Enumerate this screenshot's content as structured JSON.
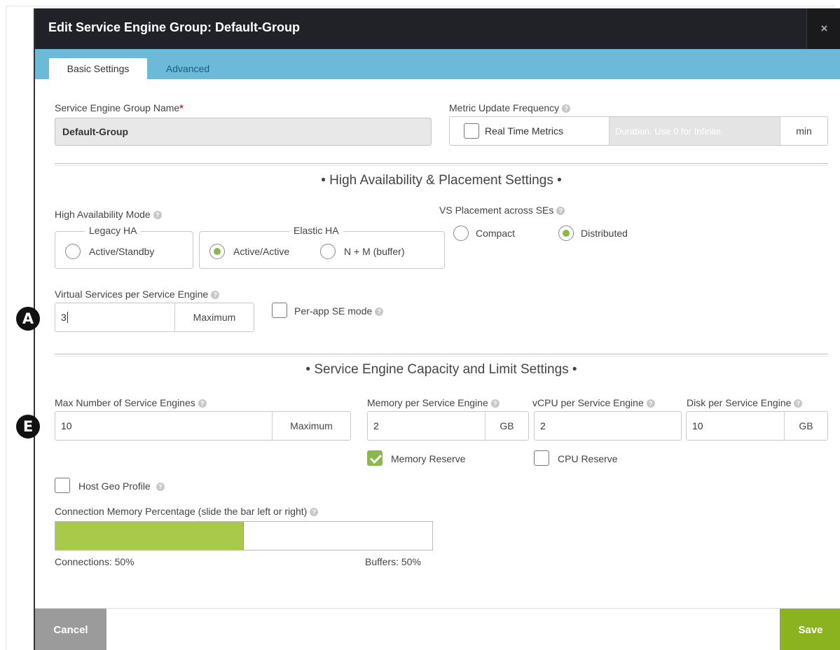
{
  "dialog": {
    "title": "Edit Service Engine Group: Default-Group",
    "close_glyph": "×"
  },
  "tabs": [
    {
      "label": "Basic Settings",
      "active": true
    },
    {
      "label": "Advanced",
      "active": false
    }
  ],
  "se_group_name": {
    "label": "Service Engine Group Name",
    "required_mark": "*",
    "value": "Default-Group"
  },
  "metric_update": {
    "label": "Metric Update Frequency",
    "real_time_label": "Real Time Metrics",
    "real_time_checked": false,
    "duration_placeholder": "Duration. Use 0 for Infinite.",
    "unit": "min"
  },
  "sections": {
    "ha_placement": "• High Availability & Placement Settings •",
    "capacity": "• Service Engine Capacity and Limit Settings •"
  },
  "ha_mode": {
    "label": "High Availability Mode",
    "legacy_legend": "Legacy HA",
    "elastic_legend": "Elastic HA",
    "options": [
      {
        "label": "Active/Standby",
        "checked": false
      },
      {
        "label": "Active/Active",
        "checked": true
      },
      {
        "label": "N + M (buffer)",
        "checked": false
      }
    ]
  },
  "vs_placement": {
    "label": "VS Placement across SEs",
    "options": [
      {
        "label": "Compact",
        "checked": false
      },
      {
        "label": "Distributed",
        "checked": true
      }
    ]
  },
  "vs_per_se": {
    "label": "Virtual Services per Service Engine",
    "value": "3",
    "unit": "Maximum"
  },
  "per_app": {
    "label": "Per-app SE mode",
    "checked": false
  },
  "max_se": {
    "label": "Max Number of Service Engines",
    "value": "10",
    "unit": "Maximum"
  },
  "memory_per_se": {
    "label": "Memory per Service Engine",
    "value": "2",
    "unit": "GB"
  },
  "vcpu_per_se": {
    "label": "vCPU per Service Engine",
    "value": "2"
  },
  "disk_per_se": {
    "label": "Disk per Service Engine",
    "value": "10",
    "unit": "GB"
  },
  "memory_reserve": {
    "label": "Memory Reserve",
    "checked": true
  },
  "cpu_reserve": {
    "label": "CPU Reserve",
    "checked": false
  },
  "host_geo": {
    "label": "Host Geo Profile",
    "checked": false
  },
  "connection_memory": {
    "label": "Connection Memory Percentage (slide the bar left or right)",
    "connections_label": "Connections: 50%",
    "buffers_label": "Buffers: 50%",
    "connections_percent": 50
  },
  "footer": {
    "cancel_label": "Cancel",
    "save_label": "Save"
  },
  "markers": {
    "a": "A",
    "e": "E"
  },
  "icons": {
    "help": "?"
  },
  "colors": {
    "header_bg": "#202227",
    "tab_bar": "#6cb9d8",
    "accent_green": "#8bb84a",
    "save_green": "#8bb21f",
    "slider_fill": "#a9c94b",
    "cancel_gray": "#9b9b9b"
  }
}
